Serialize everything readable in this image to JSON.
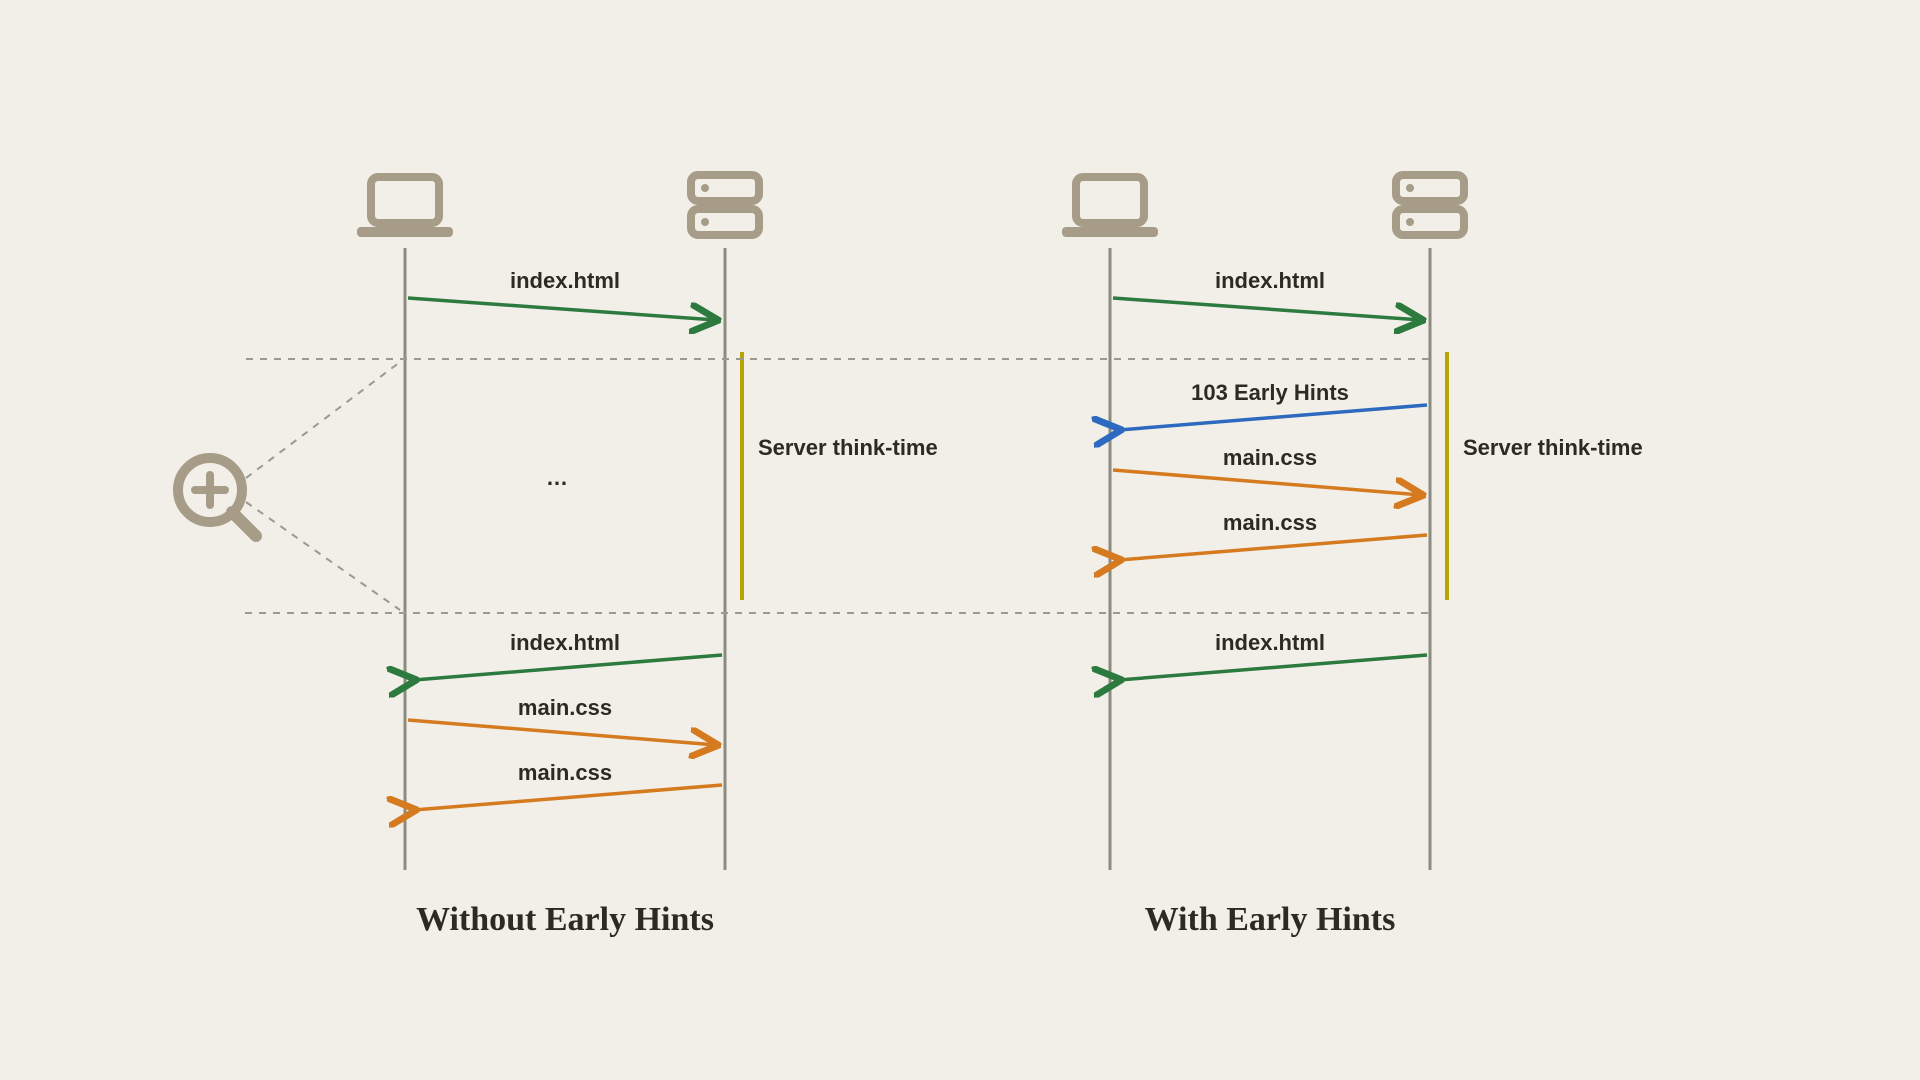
{
  "colors": {
    "bg": "#f1efe8",
    "icon": "#a69c87",
    "lifeline": "#8b8b7f",
    "dashed": "#9a9a90",
    "green": "#2d7a3e",
    "blue": "#2d6abf",
    "orange": "#d57a1f",
    "yellow": "#b5a500",
    "text": "#2b2b22"
  },
  "left": {
    "title": "Without Early Hints",
    "messages": {
      "req_index": "index.html",
      "think_label": "Server think-time",
      "idle_text": "…",
      "resp_index": "index.html",
      "req_css": "main.css",
      "resp_css": "main.css"
    }
  },
  "right": {
    "title": "With Early Hints",
    "messages": {
      "req_index": "index.html",
      "early_hints": "103 Early Hints",
      "think_label": "Server think-time",
      "req_css": "main.css",
      "resp_css": "main.css",
      "resp_index": "index.html"
    }
  },
  "zoom_icon": "zoom-in"
}
